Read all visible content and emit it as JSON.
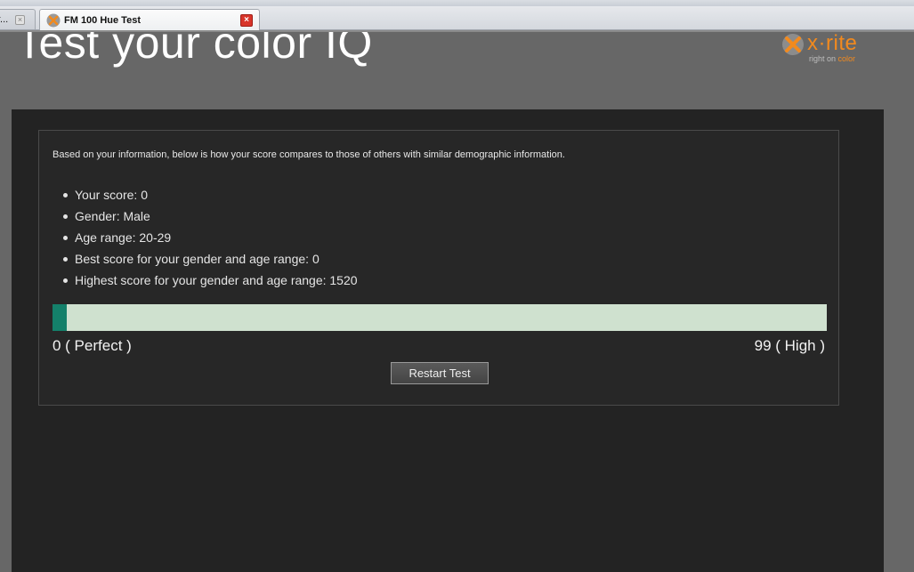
{
  "browser": {
    "tabs": [
      {
        "title": "r...",
        "active": false
      },
      {
        "title": "FM 100 Hue Test",
        "active": true
      }
    ],
    "close_glyph": "×"
  },
  "page": {
    "title": "Test your color IQ",
    "logo": {
      "brand": "x·rite",
      "tagline_prefix": "right on ",
      "tagline_accent": "color",
      "brand_color": "#f28a1e"
    }
  },
  "results": {
    "intro": "Based on your information, below is how your score compares to those of others with similar demographic information.",
    "stats": [
      "Your score: 0",
      "Gender: Male",
      "Age range: 20-29",
      "Best score for your gender and age range: 0",
      "Highest score for your gender and age range: 1520"
    ],
    "score_bar": {
      "min_label": "0 ( Perfect )",
      "max_label": "99 ( High )",
      "value": 0,
      "min": 0,
      "max": 99,
      "fill_color": "#14806a",
      "track_color": "#cfe1cf"
    },
    "restart_label": "Restart Test"
  }
}
